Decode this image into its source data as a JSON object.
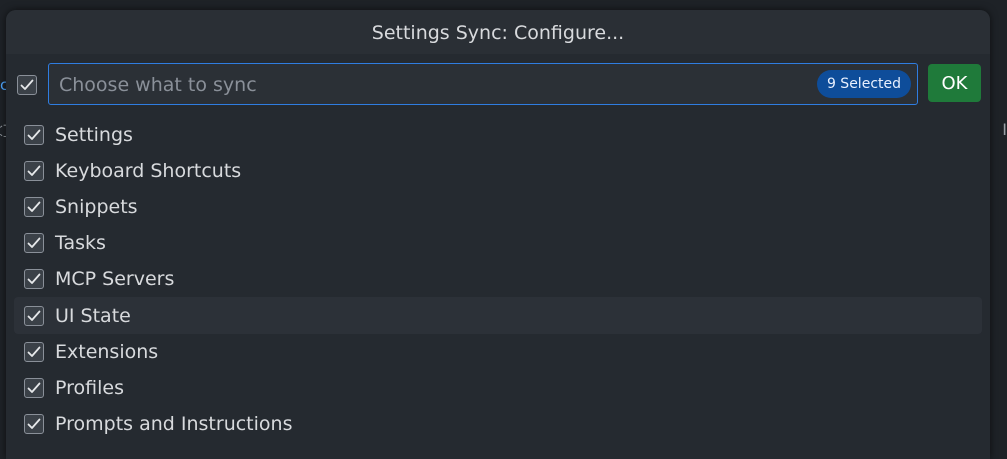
{
  "dialog": {
    "title": "Settings Sync: Configure...",
    "search": {
      "placeholder": "Choose what to sync",
      "value": "",
      "selected_badge": "9 Selected"
    },
    "ok_label": "OK",
    "items": [
      {
        "label": "Settings",
        "checked": true
      },
      {
        "label": "Keyboard Shortcuts",
        "checked": true
      },
      {
        "label": "Snippets",
        "checked": true
      },
      {
        "label": "Tasks",
        "checked": true
      },
      {
        "label": "MCP Servers",
        "checked": true
      },
      {
        "label": "UI State",
        "checked": true,
        "hovered": true
      },
      {
        "label": "Extensions",
        "checked": true
      },
      {
        "label": "Profiles",
        "checked": true
      },
      {
        "label": "Prompts and Instructions",
        "checked": true
      }
    ]
  },
  "colors": {
    "accent": "#2f7de1",
    "ok_button": "#1f7a3a",
    "badge": "#0e4d9a"
  },
  "icons": {
    "checkbox": "check-icon"
  }
}
